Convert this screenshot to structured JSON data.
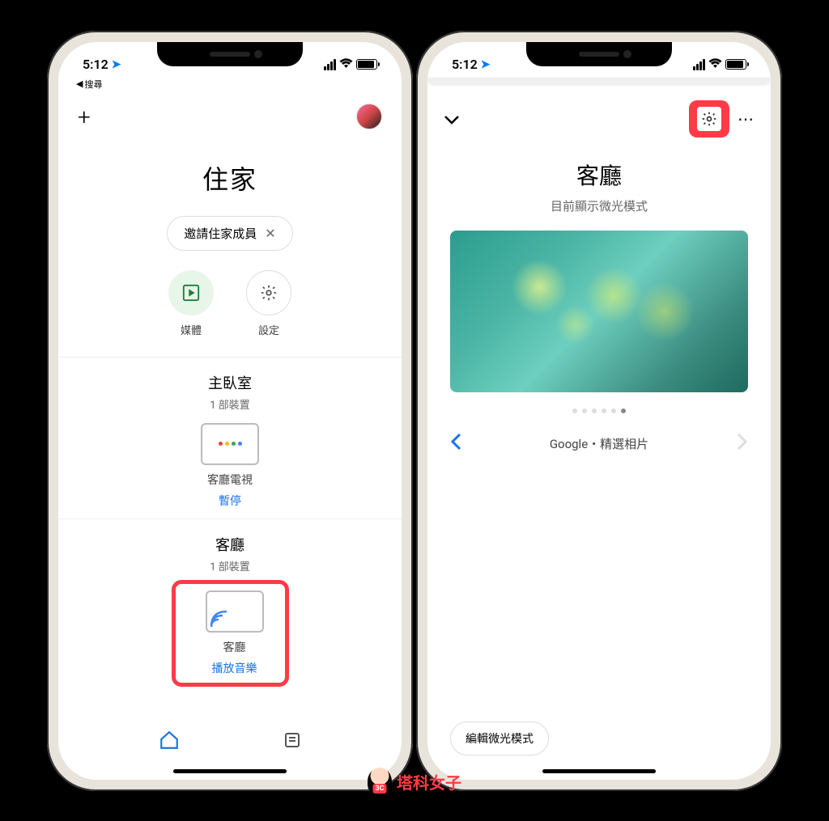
{
  "status": {
    "time": "5:12",
    "back_label": "搜尋"
  },
  "phone1": {
    "title": "住家",
    "invite_label": "邀請住家成員",
    "actions": {
      "media": "媒體",
      "settings": "設定"
    },
    "rooms": [
      {
        "name": "主臥室",
        "count": "1 部裝置",
        "device_name": "客廳電視",
        "device_action": "暫停"
      },
      {
        "name": "客廳",
        "count": "1 部裝置",
        "device_name": "客廳",
        "device_action": "播放音樂"
      }
    ]
  },
  "phone2": {
    "title": "客廳",
    "subtitle": "目前顯示微光模式",
    "carousel_label": "Google・精選相片",
    "edit_button": "編輯微光模式"
  },
  "watermark": {
    "text": "塔科女子",
    "badge": "3C"
  }
}
